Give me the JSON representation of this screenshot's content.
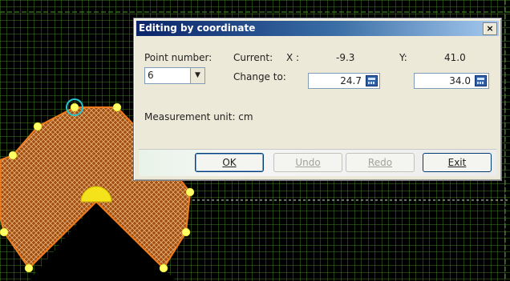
{
  "dialog": {
    "title": "Editing by coordinate",
    "close_glyph": "×",
    "point_number_label": "Point number:",
    "point_number_value": "6",
    "current_label": "Current:",
    "x_label": "X :",
    "current_x": "-9.3",
    "y_label": "Y:",
    "current_y": "41.0",
    "change_to_label": "Change to:",
    "new_x": "24.7",
    "new_y": "34.0",
    "measurement_unit": "Measurement unit: cm",
    "buttons": {
      "ok": "OK",
      "undo": "Undo",
      "redo": "Redo",
      "exit": "Exit"
    }
  },
  "colors": {
    "grid_line": "#4a8a2a",
    "shape_outline": "#f07b1e",
    "vertex": "#ffff66",
    "selected_vertex_ring": "#22c7cf",
    "dialog_bg": "#ece9d8",
    "titlebar_start": "#0a246a"
  },
  "icons": {
    "calculator": "calculator-icon",
    "dropdown": "chevron-down-icon",
    "close": "close-icon"
  }
}
